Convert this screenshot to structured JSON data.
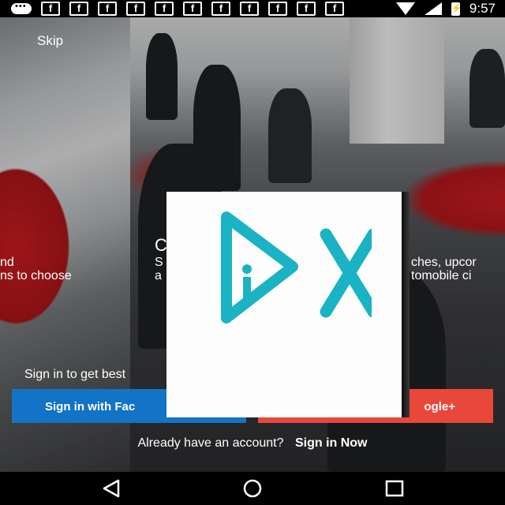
{
  "status_bar": {
    "notification_icons": [
      "messages-icon",
      "facebook-icon",
      "facebook-icon",
      "facebook-icon",
      "facebook-icon",
      "facebook-icon",
      "facebook-icon",
      "facebook-icon",
      "facebook-icon",
      "facebook-icon",
      "facebook-icon",
      "facebook-icon"
    ],
    "facebook_glyph": "f",
    "time": "9:57"
  },
  "onboarding": {
    "skip_label": "Skip",
    "slides": {
      "prev_line1": "nd",
      "prev_line2": "ns to choose",
      "current_title": "C",
      "current_line1": "S",
      "current_line2": "a",
      "next_line1": "ches, upcor",
      "next_line2": "tomobile ci"
    },
    "tagline": "Sign in to get best"
  },
  "auth": {
    "facebook_button": "Sign in with Fac",
    "google_button": "ogle+",
    "account_prompt": "Already have an account?",
    "sign_in_now": "Sign in Now"
  },
  "overlay": {
    "logo_icon": "play-x-logo-icon",
    "logo_color": "#1ab3c4"
  },
  "nav_bar": {
    "buttons": [
      "back-icon",
      "home-icon",
      "recents-icon"
    ]
  },
  "colors": {
    "facebook_blue": "#1373c6",
    "google_red": "#e9473a"
  }
}
